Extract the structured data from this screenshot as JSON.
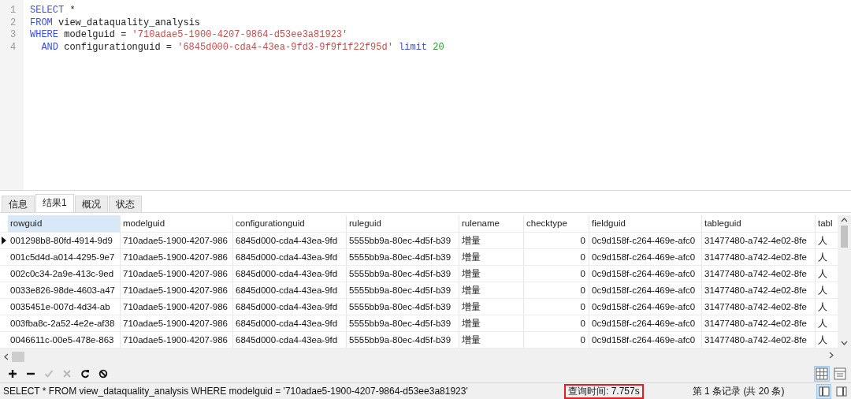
{
  "editor": {
    "lines": [
      {
        "number": "1",
        "indented": false,
        "tokens": [
          {
            "kind": "keyword",
            "text": "SELECT"
          },
          {
            "kind": "plain",
            "text": "*"
          }
        ]
      },
      {
        "number": "2",
        "indented": false,
        "tokens": [
          {
            "kind": "keyword",
            "text": "FROM"
          },
          {
            "kind": "plain",
            "text": "view_dataquality_analysis"
          }
        ]
      },
      {
        "number": "3",
        "indented": false,
        "tokens": [
          {
            "kind": "keyword",
            "text": "WHERE"
          },
          {
            "kind": "plain",
            "text": "modelguid ="
          },
          {
            "kind": "string",
            "text": "'710adae5-1900-4207-9864-d53ee3a81923'"
          }
        ]
      },
      {
        "number": "4",
        "indented": true,
        "tokens": [
          {
            "kind": "keyword",
            "text": "AND"
          },
          {
            "kind": "plain",
            "text": "configurationguid ="
          },
          {
            "kind": "string",
            "text": "'6845d000-cda4-43ea-9fd3-9f9f1f22f95d'"
          },
          {
            "kind": "keyword",
            "text": "limit"
          },
          {
            "kind": "number",
            "text": "20"
          }
        ]
      }
    ]
  },
  "tabs": [
    {
      "label": "信息",
      "selected": false
    },
    {
      "label": "结果1",
      "selected": true
    },
    {
      "label": "概况",
      "selected": false
    },
    {
      "label": "状态",
      "selected": false
    }
  ],
  "table": {
    "columns": [
      {
        "label": "rowguid",
        "selected": true
      },
      {
        "label": "modelguid",
        "selected": false
      },
      {
        "label": "configurationguid",
        "selected": false
      },
      {
        "label": "ruleguid",
        "selected": false
      },
      {
        "label": "rulename",
        "selected": false
      },
      {
        "label": "checktype",
        "selected": false
      },
      {
        "label": "fieldguid",
        "selected": false
      },
      {
        "label": "tableguid",
        "selected": false
      },
      {
        "label": "tabl",
        "selected": false
      }
    ],
    "rows": [
      {
        "current": true,
        "cells": [
          "001298b8-80fd-4914-9d9",
          "710adae5-1900-4207-986",
          "6845d000-cda4-43ea-9fd",
          "5555bb9a-80ec-4d5f-b39",
          "增量",
          "0",
          "0c9d158f-c264-469e-afc0",
          "31477480-a742-4e02-8fe",
          "人"
        ]
      },
      {
        "current": false,
        "cells": [
          "001c5d4d-a014-4295-9e7",
          "710adae5-1900-4207-986",
          "6845d000-cda4-43ea-9fd",
          "5555bb9a-80ec-4d5f-b39",
          "增量",
          "0",
          "0c9d158f-c264-469e-afc0",
          "31477480-a742-4e02-8fe",
          "人"
        ]
      },
      {
        "current": false,
        "cells": [
          "002c0c34-2a9e-413c-9ed",
          "710adae5-1900-4207-986",
          "6845d000-cda4-43ea-9fd",
          "5555bb9a-80ec-4d5f-b39",
          "增量",
          "0",
          "0c9d158f-c264-469e-afc0",
          "31477480-a742-4e02-8fe",
          "人"
        ]
      },
      {
        "current": false,
        "cells": [
          "0033e826-98de-4603-a47",
          "710adae5-1900-4207-986",
          "6845d000-cda4-43ea-9fd",
          "5555bb9a-80ec-4d5f-b39",
          "增量",
          "0",
          "0c9d158f-c264-469e-afc0",
          "31477480-a742-4e02-8fe",
          "人"
        ]
      },
      {
        "current": false,
        "cells": [
          "0035451e-007d-4d34-ab",
          "710adae5-1900-4207-986",
          "6845d000-cda4-43ea-9fd",
          "5555bb9a-80ec-4d5f-b39",
          "增量",
          "0",
          "0c9d158f-c264-469e-afc0",
          "31477480-a742-4e02-8fe",
          "人"
        ]
      },
      {
        "current": false,
        "cells": [
          "003fba8c-2a52-4e2e-af38",
          "710adae5-1900-4207-986",
          "6845d000-cda4-43ea-9fd",
          "5555bb9a-80ec-4d5f-b39",
          "增量",
          "0",
          "0c9d158f-c264-469e-afc0",
          "31477480-a742-4e02-8fe",
          "人"
        ]
      },
      {
        "current": false,
        "cells": [
          "0046611c-00e5-478e-863",
          "710adae5-1900-4207-986",
          "6845d000-cda4-43ea-9fd",
          "5555bb9a-80ec-4d5f-b39",
          "增量",
          "0",
          "0c9d158f-c264-469e-afc0",
          "31477480-a742-4e02-8fe",
          "人"
        ]
      }
    ]
  },
  "toolbar": {
    "buttons": [
      {
        "kind": "add",
        "disabled": false
      },
      {
        "kind": "remove",
        "disabled": false
      },
      {
        "kind": "apply",
        "disabled": true
      },
      {
        "kind": "discard",
        "disabled": true
      },
      {
        "kind": "refresh",
        "disabled": false
      },
      {
        "kind": "stop",
        "disabled": false
      }
    ],
    "views": [
      {
        "kind": "grid",
        "selected": true
      },
      {
        "kind": "form",
        "selected": false
      }
    ]
  },
  "status_bar": {
    "sql": "SELECT * FROM view_dataquality_analysis WHERE modelguid = '710adae5-1900-4207-9864-d53ee3a81923'",
    "query_time": "查询时间: 7.757s",
    "record": "第 1 条记录 (共 20 条)",
    "panels": [
      {
        "kind": "grid",
        "selected": true
      },
      {
        "kind": "side",
        "selected": false
      }
    ]
  }
}
